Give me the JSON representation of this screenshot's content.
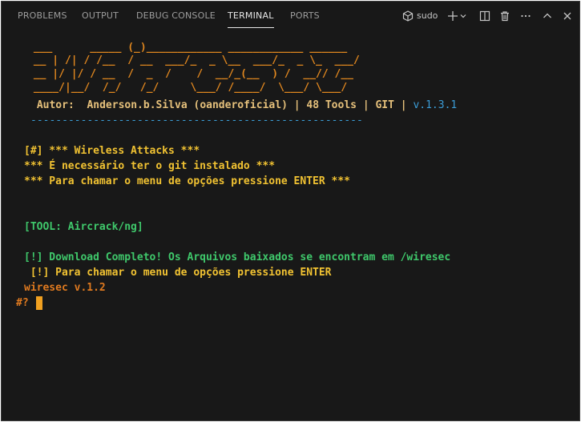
{
  "panel": {
    "tabs": [
      {
        "label": "PROBLEMS"
      },
      {
        "label": "OUTPUT"
      },
      {
        "label": "DEBUG CONSOLE"
      },
      {
        "label": "TERMINAL",
        "active": true
      },
      {
        "label": "PORTS"
      }
    ],
    "terminal_name": "sudo",
    "icons": [
      "terminal-icon",
      "plus-icon",
      "chevron-down-icon",
      "split-icon",
      "trash-icon",
      "ellipsis-icon",
      "chevron-up-icon",
      "close-icon"
    ]
  },
  "terminal": {
    "ascii_banner": [
      " ___      _____ (_)____________ ____________ ______",
      " __ | /| / /__  / __  ___/_  _ \\__  ___/_  _ \\_  ___/",
      " __ |/ |/ / __  /  _  /    /  __/_(__  ) /  __// /__",
      " ____/|__/  /_/   /_/     \\___/ /____/  \\___/ \\___/"
    ],
    "author_line": {
      "prefix": " Autor:  Anderson.b.Silva (oanderoficial) | 48 Tools | GIT | ",
      "version": "v.1.3.1"
    },
    "separator": "-----------------------------------------------------",
    "header_line": "[#] *** Wireless Attacks ***",
    "git_notice": "*** É necessário ter o git instalado ***",
    "menu_notice": "*** Para chamar o menu de opções pressione ENTER ***",
    "tool_line": "[TOOL: Aircrack/ng]",
    "download_line": "[!] Download Completo! Os Arquivos baixados se encontram em /wiresec",
    "menu_hint": " [!] Para chamar o menu de opções pressione ENTER",
    "app_version": "wiresec v.1.2",
    "prompt": "#?"
  },
  "colors": {
    "background": "#181818",
    "accent_orange": "#e08b26",
    "accent_green": "#3fc86b",
    "accent_blue": "#3b9cd6"
  }
}
